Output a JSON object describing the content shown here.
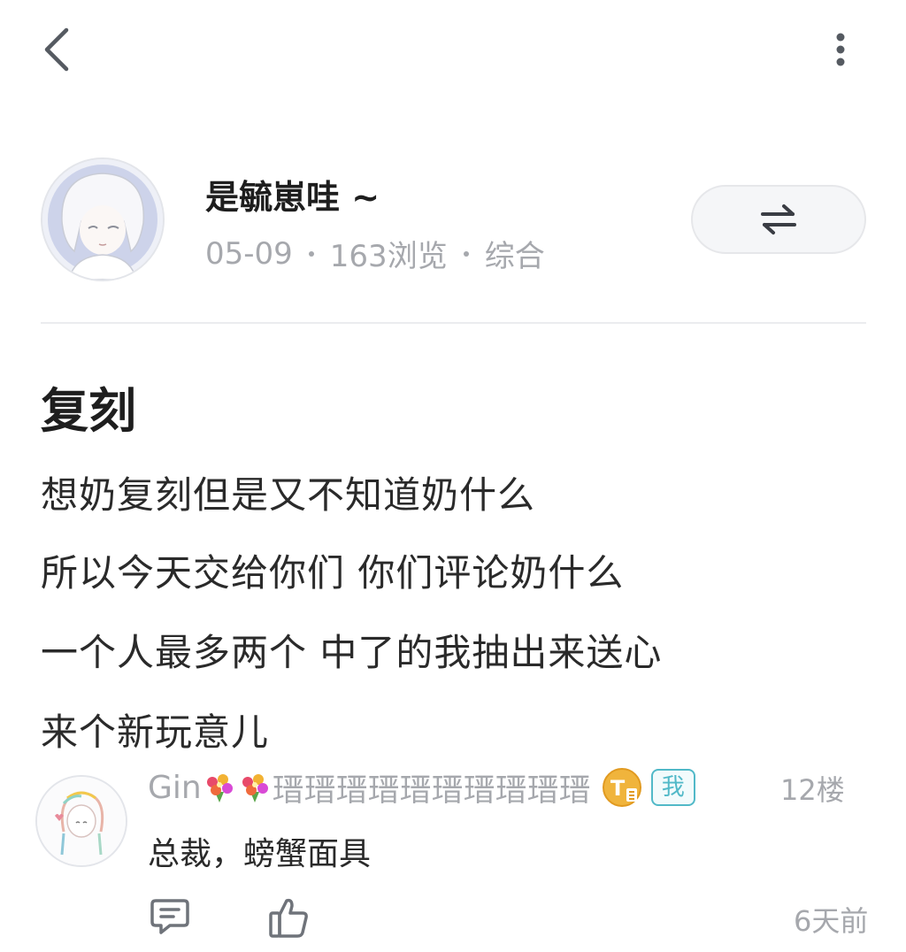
{
  "topbar": {
    "back_icon": "chevron-left-icon",
    "more_icon": "more-vertical-icon"
  },
  "author": {
    "name": "是毓崽哇 ~",
    "date": "05-09",
    "views": "163浏览",
    "category": "综合",
    "switch_icon": "swap-arrows-icon"
  },
  "post": {
    "title": "复刻",
    "lines": [
      "想奶复刻但是又不知道奶什么",
      "所以今天交给你们 你们评论奶什么",
      "一个人最多两个 中了的我抽出来送心",
      "来个新玩意儿"
    ]
  },
  "comment": {
    "username_prefix": "Gin",
    "username_suffix": "瑨瑨瑨瑨瑨瑨瑨瑨瑨瑨",
    "me_badge": "我",
    "floor": "12楼",
    "text": "总裁，螃蟹面具",
    "time": "6天前"
  },
  "colors": {
    "muted_text": "#a6a8ad",
    "accent_teal": "#51b9c8",
    "badge_gold": "#f0b43c"
  }
}
